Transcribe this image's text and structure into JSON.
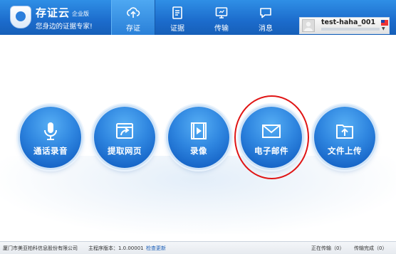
{
  "app": {
    "name": "存证云",
    "edition": "企业版",
    "slogan": "您身边的证据专家!"
  },
  "nav": {
    "items": [
      {
        "label": "存证",
        "icon": "cloud-upload-icon",
        "active": true
      },
      {
        "label": "证据",
        "icon": "document-icon",
        "active": false
      },
      {
        "label": "传输",
        "icon": "monitor-icon",
        "active": false
      },
      {
        "label": "消息",
        "icon": "chat-icon",
        "active": false
      }
    ]
  },
  "user": {
    "name": "test-haha_001"
  },
  "actions": [
    {
      "label": "通话录音",
      "icon": "microphone-icon"
    },
    {
      "label": "提取网页",
      "icon": "web-capture-icon"
    },
    {
      "label": "录像",
      "icon": "video-icon"
    },
    {
      "label": "电子邮件",
      "icon": "mail-icon",
      "highlighted": true
    },
    {
      "label": "文件上传",
      "icon": "folder-upload-icon"
    }
  ],
  "status": {
    "company": "厦门市美亚柏科信息股份有限公司",
    "version_label": "主程序版本：1.0.00001",
    "check_update": "检查更新",
    "transferring": "正在传输（0）",
    "transfer_done": "传输完成（0）"
  },
  "colors": {
    "header_blue": "#1c6ccc",
    "button_blue": "#2f86e0",
    "highlight_red": "#e01515"
  }
}
